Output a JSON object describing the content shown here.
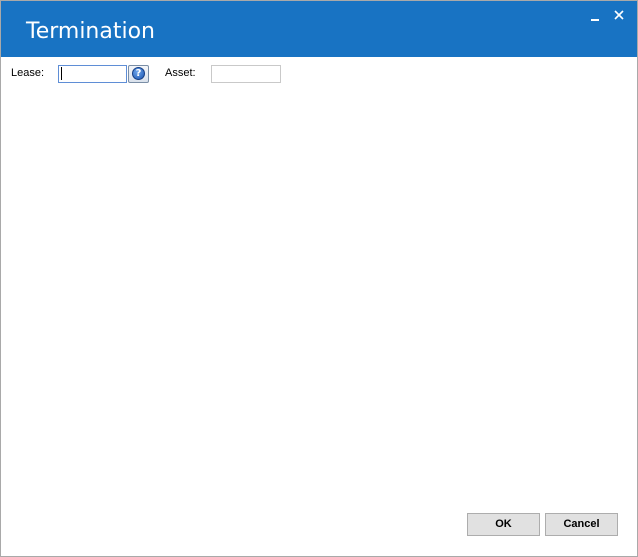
{
  "window": {
    "title": "Termination",
    "titlebar_color": "#1873c3",
    "minimize_icon": "minimize-icon",
    "close_icon": "close-icon"
  },
  "form": {
    "lease_label": "Lease:",
    "lease_value": "",
    "lookup_icon": "question-mark-icon",
    "asset_label": "Asset:",
    "asset_value": ""
  },
  "footer": {
    "ok_label": "OK",
    "cancel_label": "Cancel"
  }
}
